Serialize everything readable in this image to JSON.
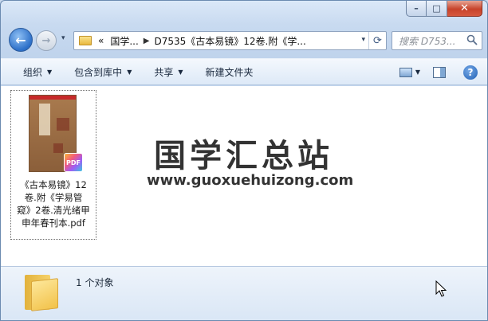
{
  "window": {
    "caption": {
      "minimize": "–",
      "maximize": "□",
      "close": "✕"
    }
  },
  "nav": {
    "back_icon": "←",
    "forward_icon": "→",
    "history_icon": "▾",
    "breadcrumb": [
      "国学...",
      "D7535《古本易镜》12卷.附《学..."
    ],
    "breadcrumb_overflow": "«",
    "address_dropdown_icon": "▾",
    "refresh_icon": "⟳",
    "search_placeholder": "搜索 D753..."
  },
  "toolbar": {
    "organize": "组织",
    "include_in_library": "包含到库中",
    "share": "共享",
    "new_folder": "新建文件夹",
    "dropdown_icon": "▼",
    "help_icon": "?"
  },
  "files": [
    {
      "name": "《古本易镜》12卷.附《学易管窥》2卷.清光绪甲申年春刊本.pdf",
      "badge": "PDF",
      "name_lines": [
        "《古本易镜》12",
        "卷.附《学易管",
        "窥》2卷.清光绪甲",
        "申年春刊本.pdf"
      ]
    }
  ],
  "watermark": {
    "title": "国学汇总站",
    "url": "www.guoxuehuizong.com"
  },
  "details": {
    "count_text": "1 个对象"
  },
  "colors": {
    "accent": "#2c6fc8",
    "close_button": "#c7432b",
    "content_bg": "#ffffff"
  }
}
